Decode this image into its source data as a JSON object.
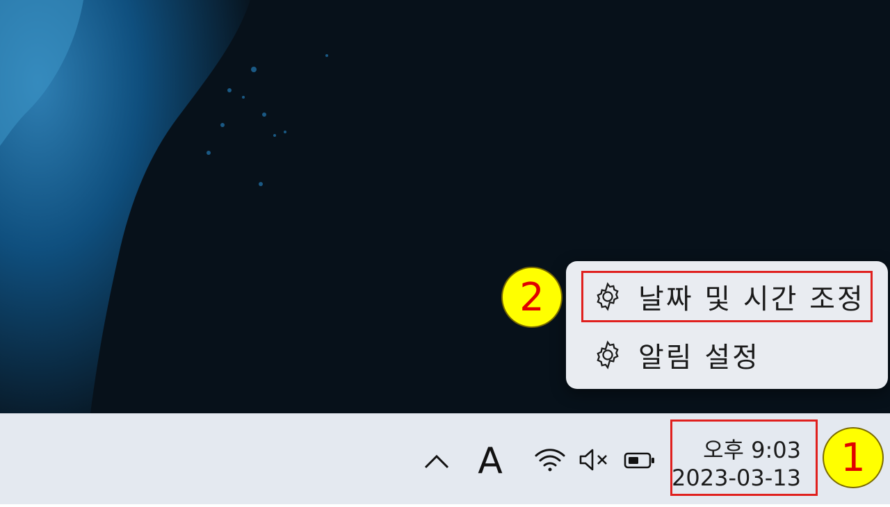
{
  "context_menu": {
    "items": [
      {
        "label": "날짜 및 시간 조정",
        "icon": "gear-icon"
      },
      {
        "label": "알림 설정",
        "icon": "gear-icon"
      }
    ]
  },
  "taskbar": {
    "tray_icons": [
      "chevron-up-icon",
      "wifi-icon",
      "volume-muted-icon",
      "battery-icon"
    ],
    "ime_indicator": "A",
    "clock": {
      "time": "오후 9:03",
      "date": "2023-03-13"
    }
  },
  "annotations": {
    "callout_1": "1",
    "callout_2": "2"
  },
  "colors": {
    "highlight_border": "#e0201e",
    "callout_fill": "#ffff00",
    "callout_text": "#e00000",
    "desktop_bg": "#07111a",
    "taskbar_bg": "#e4e9f0",
    "menu_bg": "#e9ecf1"
  }
}
